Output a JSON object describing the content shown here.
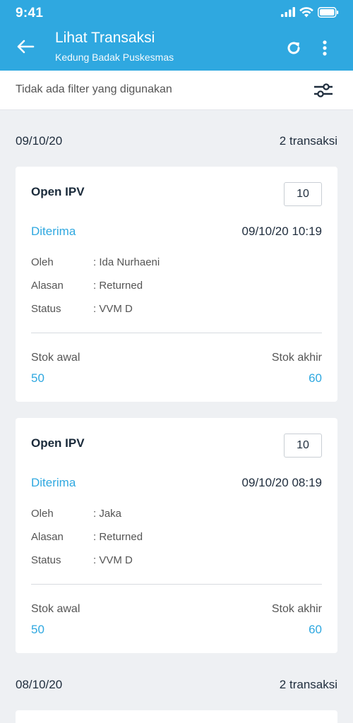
{
  "status_bar": {
    "time": "9:41"
  },
  "app_bar": {
    "title": "Lihat Transaksi",
    "subtitle": "Kedung Badak Puskesmas",
    "icons": [
      "arrow-left-icon",
      "refresh-icon",
      "more-vertical-icon"
    ]
  },
  "filter": {
    "text": "Tidak ada filter yang digunakan",
    "icon": "sliders-icon"
  },
  "colors": {
    "primary": "#2fa8e0",
    "background": "#eef0f3"
  },
  "groups": [
    {
      "date": "09/10/20",
      "count": "2 transaksi",
      "transactions": [
        {
          "title": "Open IPV",
          "quantity": "10",
          "type": "Diterima",
          "datetime": "09/10/20 10:19",
          "details": [
            {
              "label": "Oleh",
              "value": ": Ida Nurhaeni"
            },
            {
              "label": "Alasan",
              "value": ": Returned"
            },
            {
              "label": "Status",
              "value": ": VVM D"
            }
          ],
          "stok_awal_label": "Stok awal",
          "stok_awal": "50",
          "stok_akhir_label": "Stok akhir",
          "stok_akhir": "60"
        },
        {
          "title": "Open IPV",
          "quantity": "10",
          "type": "Diterima",
          "datetime": "09/10/20 08:19",
          "details": [
            {
              "label": "Oleh",
              "value": ": Jaka"
            },
            {
              "label": "Alasan",
              "value": ": Returned"
            },
            {
              "label": "Status",
              "value": ": VVM D"
            }
          ],
          "stok_awal_label": "Stok awal",
          "stok_awal": "50",
          "stok_akhir_label": "Stok akhir",
          "stok_akhir": "60"
        }
      ]
    },
    {
      "date": "08/10/20",
      "count": "2 transaksi",
      "transactions": []
    }
  ]
}
